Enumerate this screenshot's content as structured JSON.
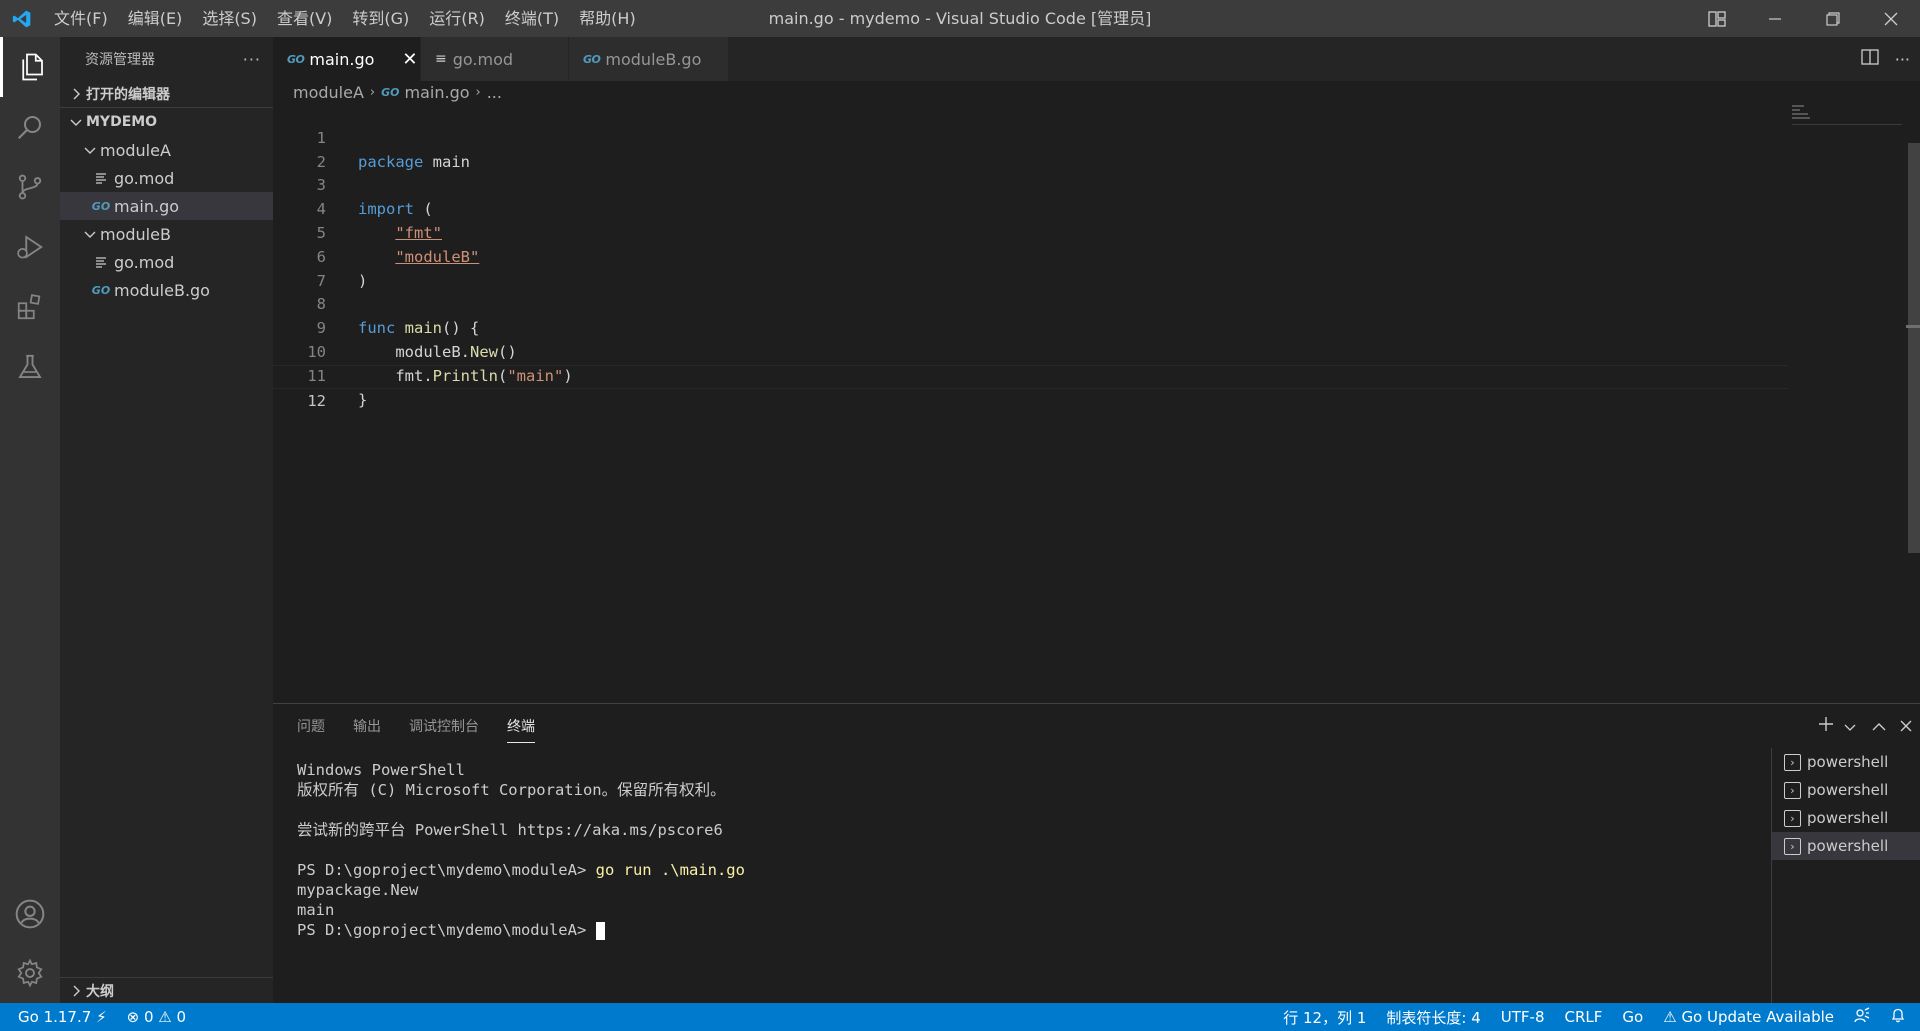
{
  "window": {
    "title": "main.go - mydemo - Visual Studio Code [管理员]",
    "menu": [
      "文件(F)",
      "编辑(E)",
      "选择(S)",
      "查看(V)",
      "转到(G)",
      "运行(R)",
      "终端(T)",
      "帮助(H)"
    ]
  },
  "activity": {
    "icons": [
      "files-icon",
      "search-icon",
      "source-control-icon",
      "run-debug-icon",
      "extensions-icon",
      "testing-icon",
      "account-icon",
      "settings-gear-icon"
    ]
  },
  "sidebar": {
    "title": "资源管理器",
    "more": "···",
    "open_editors": "打开的编辑器",
    "workspace": "MYDEMO",
    "tree": [
      {
        "label": "moduleA",
        "kind": "folder"
      },
      {
        "label": "go.mod",
        "kind": "mod"
      },
      {
        "label": "main.go",
        "kind": "go"
      },
      {
        "label": "moduleB",
        "kind": "folder"
      },
      {
        "label": "go.mod",
        "kind": "mod"
      },
      {
        "label": "moduleB.go",
        "kind": "go"
      }
    ],
    "outline": "大纲"
  },
  "tabs": [
    {
      "label": "main.go",
      "icon": "go-file-icon",
      "active": true
    },
    {
      "label": "go.mod",
      "icon": "mod-file-icon",
      "active": false
    },
    {
      "label": "moduleB.go",
      "icon": "go-file-icon",
      "active": false
    }
  ],
  "breadcrumb": {
    "folder": "moduleA",
    "file": "main.go",
    "more": "..."
  },
  "code": {
    "line_numbers": [
      "1",
      "2",
      "3",
      "4",
      "5",
      "6",
      "7",
      "8",
      "9",
      "10",
      "11",
      "12"
    ],
    "l1_kw": "package",
    "l1_rest": " main",
    "l3_kw": "import",
    "l3_rest": " (",
    "l4_indent": "    ",
    "l4_str": "\"fmt\"",
    "l5_indent": "    ",
    "l5_str": "\"moduleB\"",
    "l6": ")",
    "l8_kw": "func",
    "l8_sp": " ",
    "l8_fn": "main",
    "l8_rest": "() {",
    "l9_indent": "    ",
    "l9_pkg": "moduleB.",
    "l9_fn": "New",
    "l9_rest": "()",
    "l10_indent": "    ",
    "l10_pkg": "fmt.",
    "l10_fn": "Println",
    "l10_open": "(",
    "l10_str": "\"main\"",
    "l10_close": ")",
    "l11": "}"
  },
  "panel": {
    "tabs": [
      "问题",
      "输出",
      "调试控制台",
      "终端"
    ],
    "active_tab": "终端",
    "terminal": {
      "l1": "Windows PowerShell",
      "l2": "版权所有 (C) Microsoft Corporation。保留所有权利。",
      "l4": "尝试新的跨平台 PowerShell https://aka.ms/pscore6",
      "prompt1": "PS D:\\goproject\\mydemo\\moduleA> ",
      "cmd1": "go run .\\main.go",
      "out1": "mypackage.New",
      "out2": "main",
      "prompt2": "PS D:\\goproject\\mydemo\\moduleA> "
    },
    "terminals": [
      "powershell",
      "powershell",
      "powershell",
      "powershell"
    ]
  },
  "statusbar": {
    "go_version": "Go 1.17.7",
    "errors": "0",
    "warnings": "0",
    "position": "行 12，列 1",
    "tab_size": "制表符长度: 4",
    "encoding": "UTF-8",
    "eol": "CRLF",
    "language": "Go",
    "go_update": "Go Update Available"
  },
  "colors": {
    "accent": "#007acc",
    "keyword": "#569cd6",
    "function": "#dcdcaa",
    "string": "#ce9178",
    "go_icon": "#519aba"
  }
}
